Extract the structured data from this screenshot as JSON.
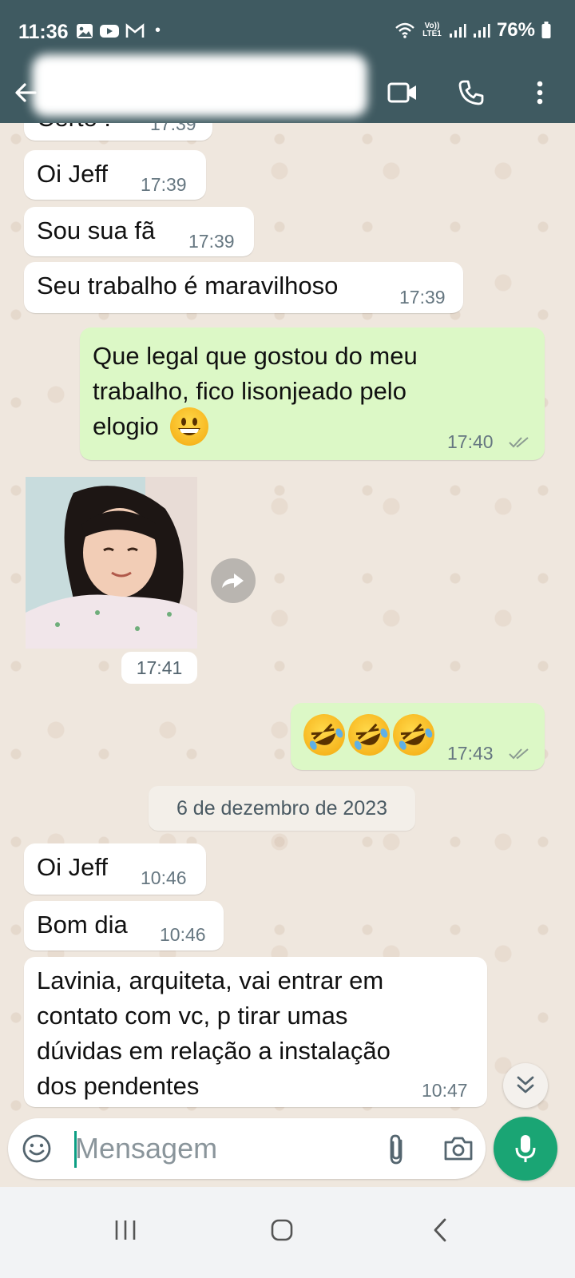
{
  "status_bar": {
    "time": "11:36",
    "dot": "•",
    "network_label": "Vo)) LTE1",
    "battery": "76%",
    "icons": [
      "gallery-icon",
      "youtube-icon",
      "gmail-icon",
      "wifi-icon",
      "signal-icon",
      "battery-icon"
    ]
  },
  "header": {
    "icons": [
      "back-arrow-icon",
      "video-call-icon",
      "phone-call-icon",
      "more-options-icon"
    ]
  },
  "messages": {
    "m0": {
      "text": "Certo !",
      "time": "17:39"
    },
    "m1": {
      "text": "Oi Jeff",
      "time": "17:39"
    },
    "m2": {
      "text": "Sou sua fã",
      "time": "17:39"
    },
    "m3": {
      "text": "Seu trabalho é maravilhoso",
      "time": "17:39"
    },
    "m4": {
      "line1": "Que legal que gostou do meu",
      "line2": "trabalho, fico lisonjeado pelo",
      "line3": "elogio",
      "emoji": "grinning-face-emoji",
      "time": "17:40",
      "status": "read"
    },
    "photo": {
      "time": "17:41"
    },
    "m5": {
      "emojis": [
        "rolling-on-floor-laughing-emoji",
        "rolling-on-floor-laughing-emoji",
        "rolling-on-floor-laughing-emoji"
      ],
      "time": "17:43",
      "status": "read"
    },
    "date_separator": "6 de dezembro de 2023",
    "m6": {
      "text": "Oi Jeff",
      "time": "10:46"
    },
    "m7": {
      "text": "Bom dia",
      "time": "10:46"
    },
    "m8": {
      "line1": "Lavinia, arquiteta, vai entrar em",
      "line2": "contato com vc, p tirar umas",
      "line3": "dúvidas em relação a instalação",
      "line4": "dos pendentes",
      "time": "10:47"
    }
  },
  "composer": {
    "placeholder": "Mensagem",
    "icons": [
      "emoji-icon",
      "attach-icon",
      "camera-icon",
      "mic-icon"
    ]
  },
  "colors": {
    "header_bg": "#3f5a61",
    "chat_bg": "#efe7de",
    "outgoing_bubble": "#dcf8c6",
    "incoming_bubble": "#ffffff",
    "accent_green": "#1aa574"
  }
}
